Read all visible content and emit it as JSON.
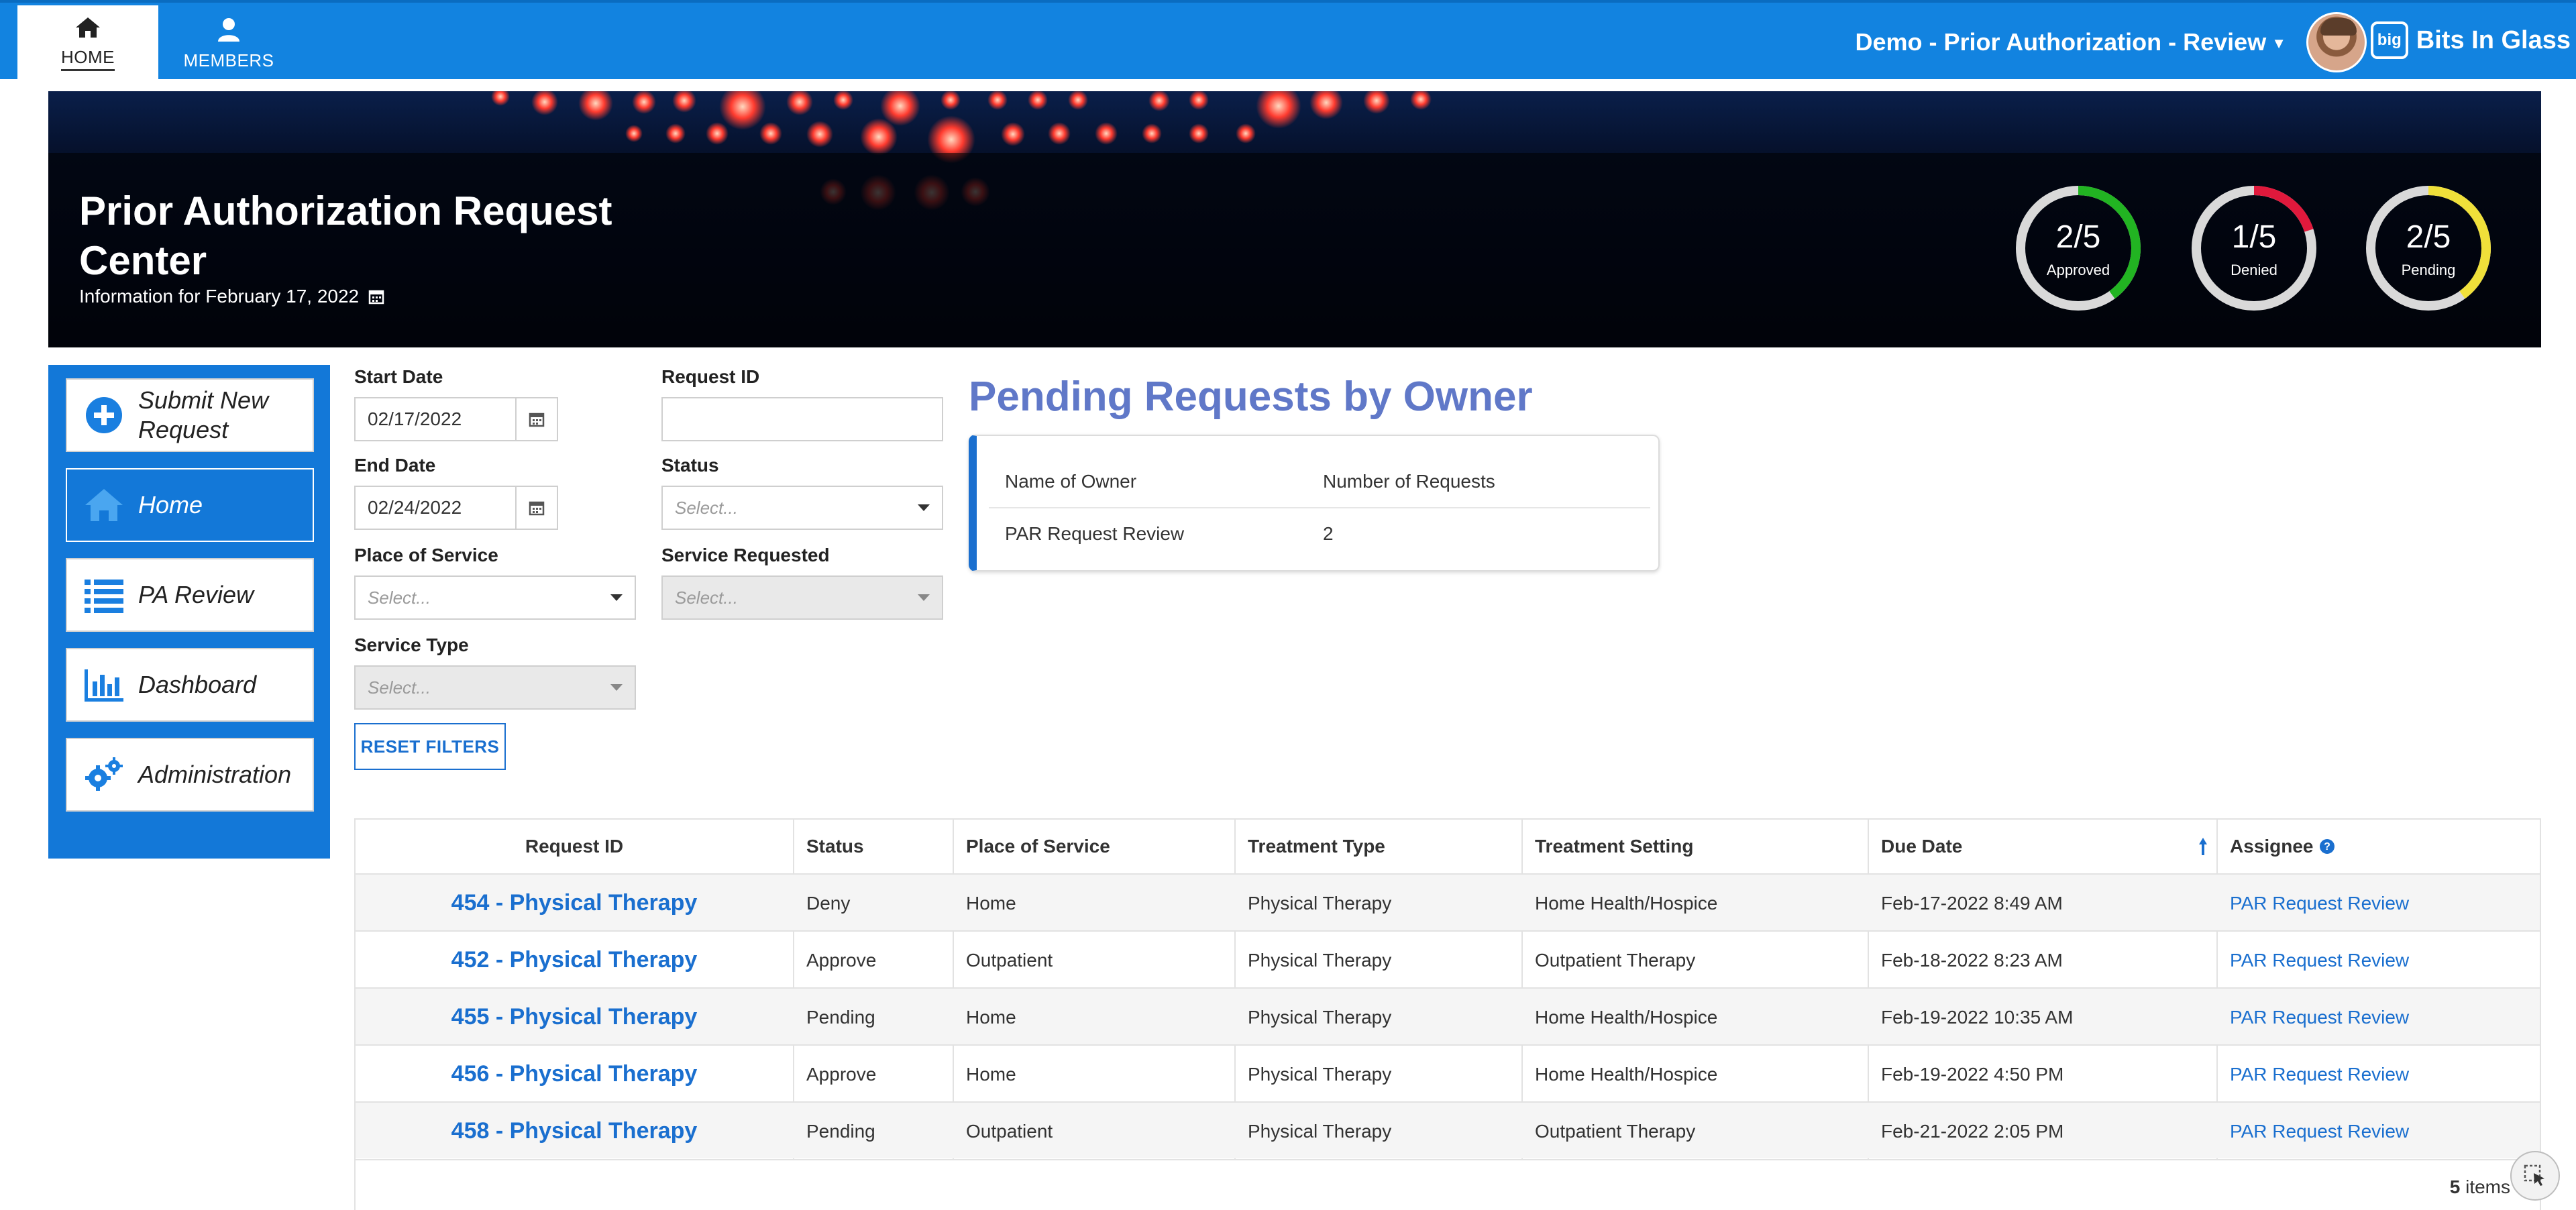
{
  "nav": {
    "home_label": "HOME",
    "members_label": "MEMBERS",
    "app_title": "Demo - Prior Authorization - Review",
    "brand_name": "Bits In Glass",
    "brand_logo_text": "big"
  },
  "hero": {
    "title": "Prior Authorization Request Center",
    "subtitle": "Information for February 17, 2022",
    "gauges": [
      {
        "value": "2/5",
        "label": "Approved",
        "fraction": 0.4,
        "color": "#22b422"
      },
      {
        "value": "1/5",
        "label": "Denied",
        "fraction": 0.2,
        "color": "#e0193c"
      },
      {
        "value": "2/5",
        "label": "Pending",
        "fraction": 0.4,
        "color": "#f0e03a"
      }
    ]
  },
  "sidebar": {
    "items": [
      {
        "label": "Submit New Request",
        "icon": "plus-circle-icon"
      },
      {
        "label": "Home",
        "icon": "home-icon"
      },
      {
        "label": "PA Review",
        "icon": "list-icon"
      },
      {
        "label": "Dashboard",
        "icon": "bar-chart-icon"
      },
      {
        "label": "Administration",
        "icon": "gears-icon"
      }
    ]
  },
  "filters": {
    "start_date_label": "Start Date",
    "start_date_value": "02/17/2022",
    "end_date_label": "End Date",
    "end_date_value": "02/24/2022",
    "place_of_service_label": "Place of Service",
    "place_of_service_placeholder": "Select...",
    "service_type_label": "Service Type",
    "service_type_placeholder": "Select...",
    "request_id_label": "Request ID",
    "request_id_value": "",
    "status_label": "Status",
    "status_placeholder": "Select...",
    "service_requested_label": "Service Requested",
    "service_requested_placeholder": "Select...",
    "reset_label": "RESET FILTERS"
  },
  "pending": {
    "title": "Pending Requests by Owner",
    "col_owner": "Name of Owner",
    "col_count": "Number of Requests",
    "rows": [
      {
        "owner": "PAR Request Review",
        "count": "2"
      }
    ]
  },
  "table": {
    "headers": [
      "Request ID",
      "Status",
      "Place of Service",
      "Treatment Type",
      "Treatment Setting",
      "Due Date",
      "Assignee"
    ],
    "rows": [
      {
        "id": "454 - Physical Therapy",
        "status": "Deny",
        "place": "Home",
        "type": "Physical Therapy",
        "setting": "Home Health/Hospice",
        "due": "Feb-17-2022 8:49 AM",
        "assignee": "PAR Request Review"
      },
      {
        "id": "452 - Physical Therapy",
        "status": "Approve",
        "place": "Outpatient",
        "type": "Physical Therapy",
        "setting": "Outpatient Therapy",
        "due": "Feb-18-2022 8:23 AM",
        "assignee": "PAR Request Review"
      },
      {
        "id": "455 - Physical Therapy",
        "status": "Pending",
        "place": "Home",
        "type": "Physical Therapy",
        "setting": "Home Health/Hospice",
        "due": "Feb-19-2022 10:35 AM",
        "assignee": "PAR Request Review"
      },
      {
        "id": "456 - Physical Therapy",
        "status": "Approve",
        "place": "Home",
        "type": "Physical Therapy",
        "setting": "Home Health/Hospice",
        "due": "Feb-19-2022 4:50 PM",
        "assignee": "PAR Request Review"
      },
      {
        "id": "458 - Physical Therapy",
        "status": "Pending",
        "place": "Outpatient",
        "type": "Physical Therapy",
        "setting": "Outpatient Therapy",
        "due": "Feb-21-2022 2:05 PM",
        "assignee": "PAR Request Review"
      }
    ],
    "item_count": "5",
    "item_count_suffix": "items"
  }
}
